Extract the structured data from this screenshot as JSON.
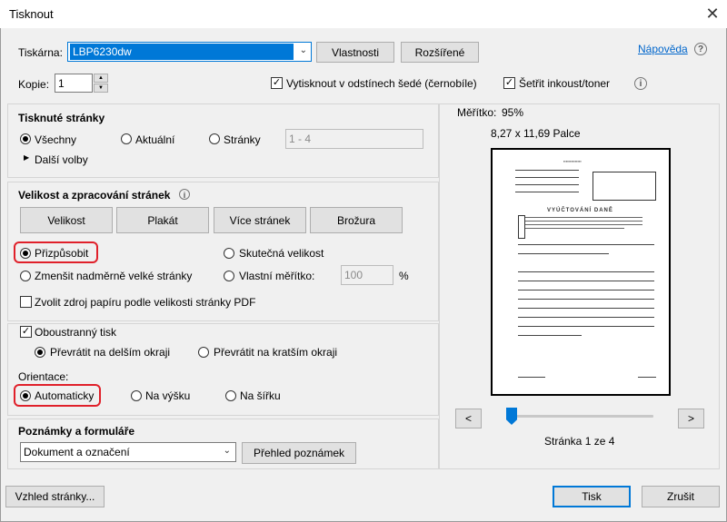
{
  "window": {
    "title": "Tisknout",
    "close_glyph": "✕"
  },
  "printer": {
    "label": "Tiskárna:",
    "selected": "LBP6230dw",
    "properties_btn": "Vlastnosti",
    "advanced_btn": "Rozšířené",
    "help_link": "Nápověda",
    "copies_label": "Kopie:",
    "copies_value": "1",
    "grayscale_label": "Vytisknout v odstínech šedé (černobíle)",
    "grayscale_checked": true,
    "save_ink_label": "Šetřit inkoust/toner",
    "save_ink_checked": true
  },
  "pages_section": {
    "title": "Tisknuté stránky",
    "all": "Všechny",
    "current": "Aktuální",
    "pages": "Stránky",
    "pages_placeholder": "1 - 4",
    "more_options": "Další volby",
    "selected": "all"
  },
  "sizing_section": {
    "title": "Velikost a zpracování stránek",
    "buttons": [
      "Velikost",
      "Plakát",
      "Více stránek",
      "Brožura"
    ],
    "fit": "Přizpůsobit",
    "actual_size": "Skutečná velikost",
    "shrink": "Zmenšit nadměrně velké stránky",
    "custom_scale": "Vlastní měřítko:",
    "custom_scale_value": "100",
    "percent": "%",
    "paper_source": "Zvolit zdroj papíru podle velikosti stránky PDF",
    "selected": "fit"
  },
  "duplex_section": {
    "title": "Oboustranný tisk",
    "checked": true,
    "long_edge": "Převrátit na delším okraji",
    "short_edge": "Převrátit na kratším okraji",
    "selected": "long_edge"
  },
  "orientation_section": {
    "title": "Orientace:",
    "auto": "Automaticky",
    "portrait": "Na výšku",
    "landscape": "Na šířku",
    "selected": "auto"
  },
  "notes_section": {
    "title": "Poznámky a formuláře",
    "selected": "Dokument a označení",
    "summary_btn": "Přehled poznámek"
  },
  "preview": {
    "scale_label": "Měřítko:",
    "scale_value": "95%",
    "paper_size": "8,27 x 11,69 Palce",
    "doc_heading": "VYÚČTOVÁNÍ DANĚ",
    "slider_position": 0.0,
    "prev": "<",
    "next": ">",
    "page_status": "Stránka 1 ze 4"
  },
  "footer": {
    "page_setup_btn": "Vzhled stránky...",
    "print_btn": "Tisk",
    "cancel_btn": "Zrušit"
  },
  "colors": {
    "accent": "#0078d7",
    "highlight": "#e0202a"
  }
}
